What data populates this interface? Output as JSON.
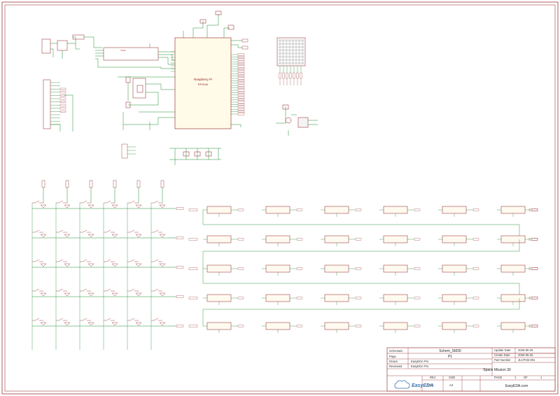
{
  "title_block": {
    "schematic_label": "Schematic",
    "schematic_name": "Schem_SM30",
    "page_label": "Page",
    "page_name": "P1",
    "drawn_label": "Drawn",
    "drawn_value": "EasyEDA Pro",
    "reviewed_label": "Reviewed",
    "reviewed_value": "EasyEDA Pro",
    "update_label": "Update Date",
    "update_value": "2026-05-25",
    "create_label": "Create Date",
    "create_value": "2026-05-25",
    "part_label": "Part Number",
    "part_value": "JLCPCB-001",
    "project_name": "Space Mission 30",
    "rev_label": "REV",
    "rev_value": "V0.1",
    "size_label": "SIZE",
    "size_value": "A3",
    "page_of_label": "PAGE",
    "page_of_value": "1",
    "of_label": "OF",
    "of_value": "1",
    "logo_text": "EasyEDA",
    "site_text": "EasyEDA.com"
  },
  "mcu": {
    "title": "Raspberry Pi",
    "part": "RP2040"
  },
  "colors": {
    "border": "#8a1c1c",
    "component": "#8a1c1c",
    "wire": "#1f8a2e",
    "label": "#b02323"
  }
}
